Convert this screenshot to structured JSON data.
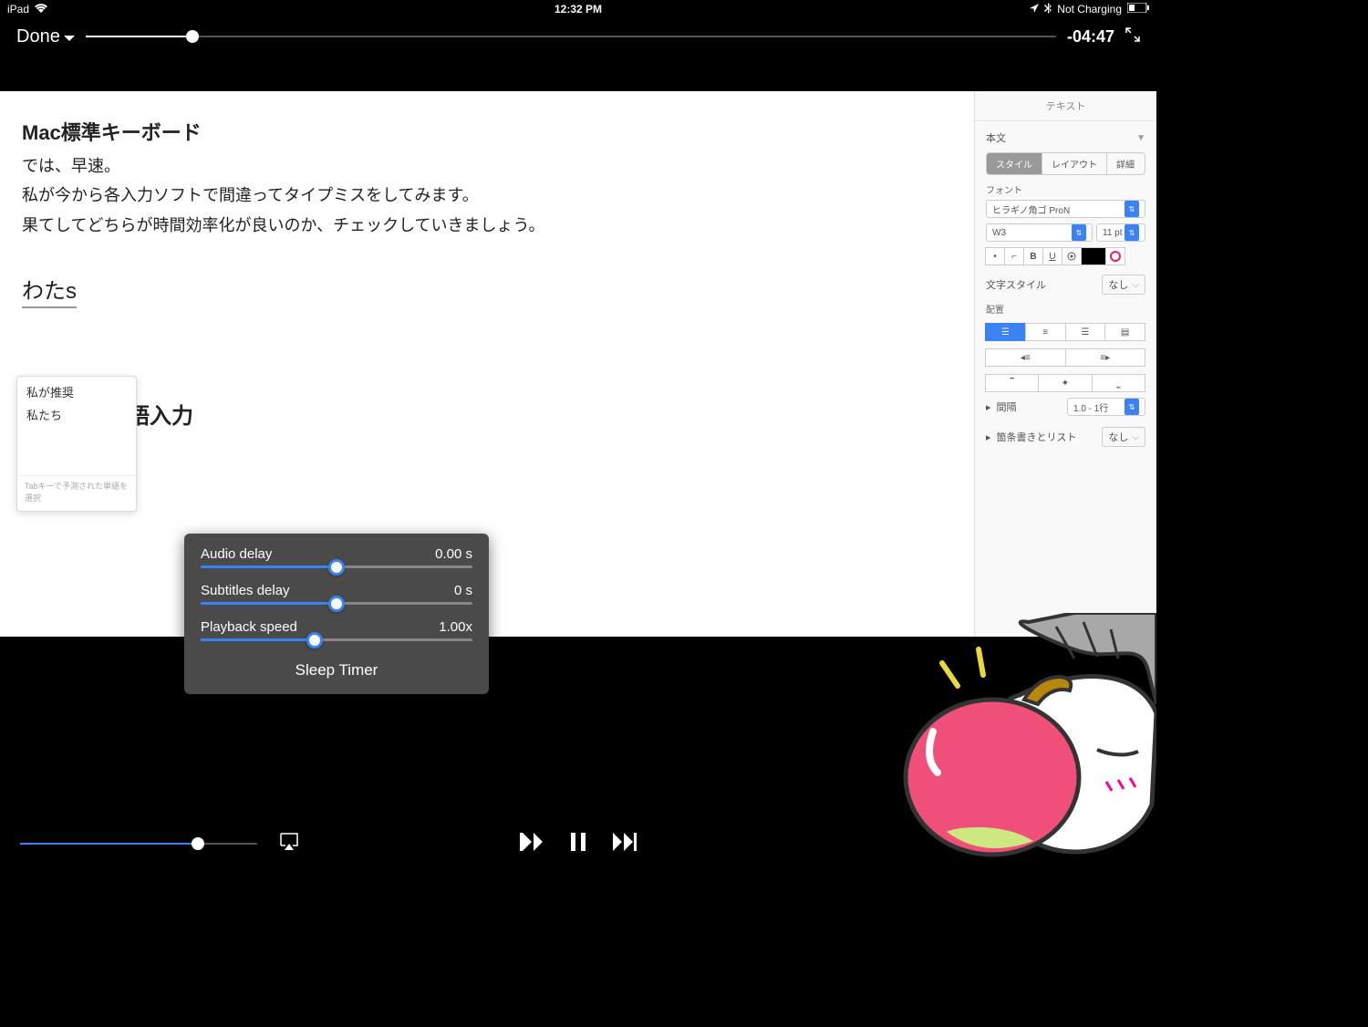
{
  "status": {
    "device": "iPad",
    "time": "12:32 PM",
    "charging": "Not Charging"
  },
  "topbar": {
    "done": "Done",
    "remaining": "-04:47",
    "progress_pct": 11
  },
  "document": {
    "title": "Mac標準キーボード",
    "line1": "では、早速。",
    "line2": "私が今から各入力ソフトで間違ってタイプミスをしてみます。",
    "line3": "果てしてどちらが時間効率化が良いのか、チェックしていきましょう。",
    "typing": "わたs",
    "behind": "語入力"
  },
  "ime": {
    "opt1": "私が推奨",
    "opt2": "私たち",
    "hint": "Tabキーで予測された単語を選択"
  },
  "sidebar": {
    "header": "テキスト",
    "style_select": "本文",
    "tabs": {
      "style": "スタイル",
      "layout": "レイアウト",
      "detail": "詳細"
    },
    "font_label": "フォント",
    "font_name": "ヒラギノ角ゴ ProN",
    "font_weight": "W3",
    "font_size": "11 pt",
    "char_style_label": "文字スタイル",
    "char_style_value": "なし",
    "align_label": "配置",
    "spacing_label": "間隔",
    "spacing_value": "1.0 - 1行",
    "list_label": "箇条書きとリスト",
    "list_value": "なし"
  },
  "settings": {
    "audio_delay_label": "Audio delay",
    "audio_delay_value": "0.00 s",
    "audio_delay_pct": 50,
    "subtitles_label": "Subtitles delay",
    "subtitles_value": "0 s",
    "subtitles_pct": 50,
    "speed_label": "Playback speed",
    "speed_value": "1.00x",
    "speed_pct": 42,
    "sleep": "Sleep Timer"
  },
  "playback": {
    "slider_pct": 75
  }
}
